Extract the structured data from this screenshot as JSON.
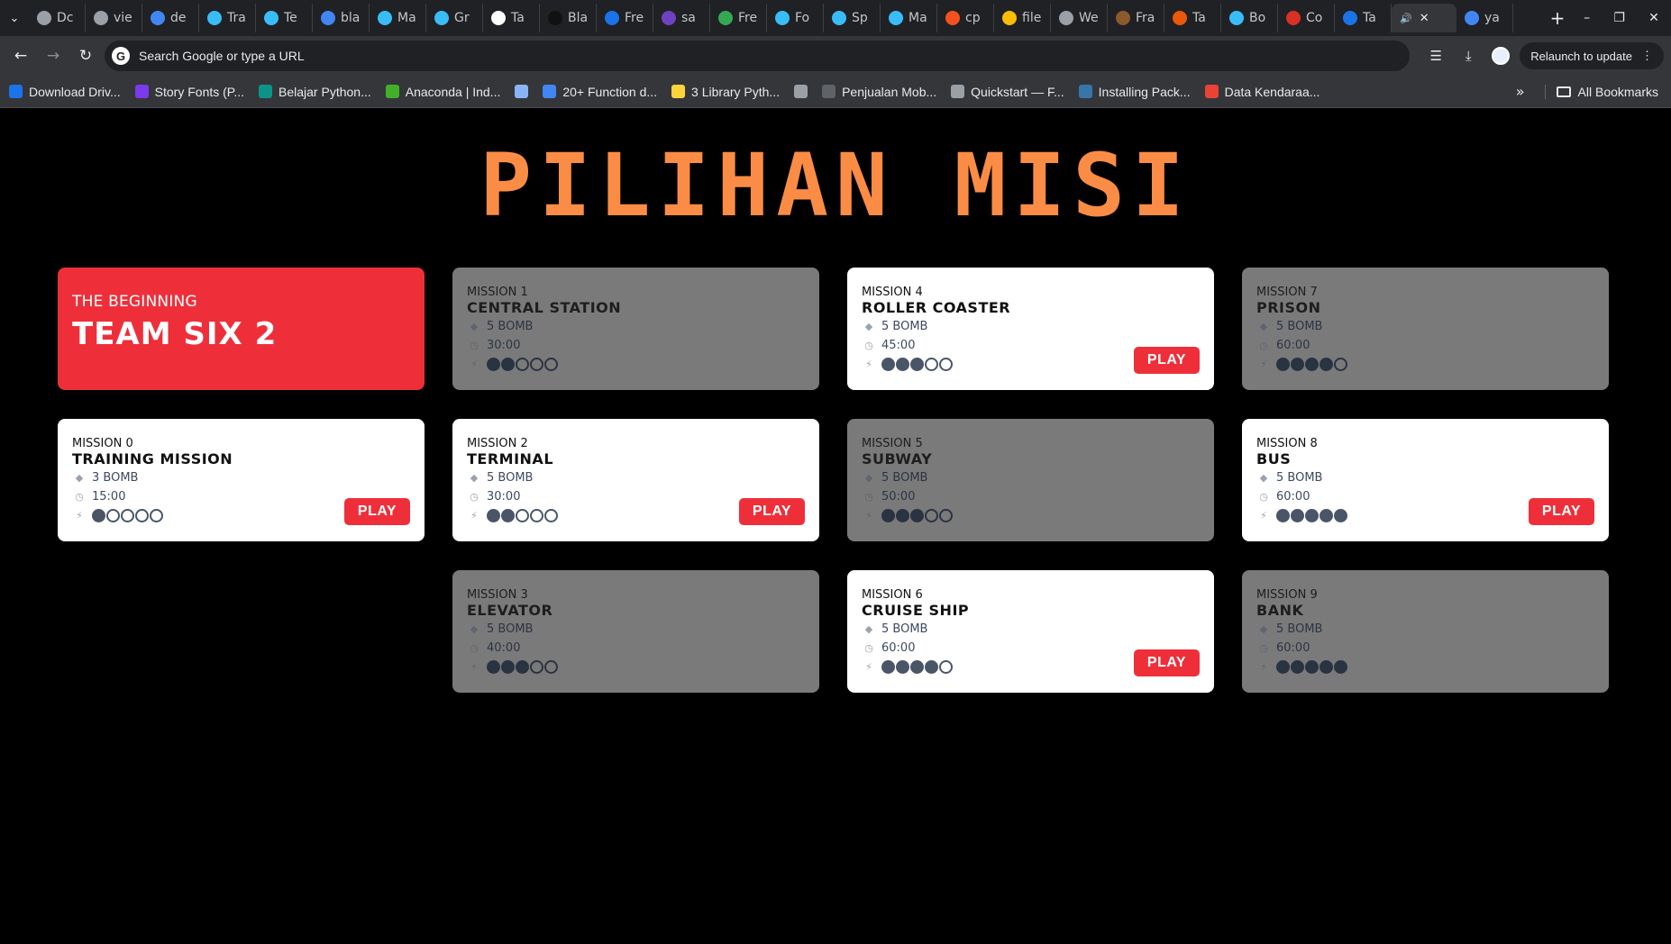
{
  "browser": {
    "tabs": [
      {
        "label": "Dc",
        "color": "#9aa0a6"
      },
      {
        "label": "vie",
        "color": "#9aa0a6"
      },
      {
        "label": "de",
        "color": "#4285f4"
      },
      {
        "label": "Tra",
        "color": "#38bdf8"
      },
      {
        "label": "Te",
        "color": "#38bdf8"
      },
      {
        "label": "bla",
        "color": "#4285f4"
      },
      {
        "label": "Ma",
        "color": "#38bdf8"
      },
      {
        "label": "Gr",
        "color": "#38bdf8"
      },
      {
        "label": "Ta",
        "color": "#ffffff"
      },
      {
        "label": "Bla",
        "color": "#111111"
      },
      {
        "label": "Fre",
        "color": "#1a73e8"
      },
      {
        "label": "sa",
        "color": "#6f42c1"
      },
      {
        "label": "Fre",
        "color": "#34a853"
      },
      {
        "label": "Fo",
        "color": "#38bdf8"
      },
      {
        "label": "Sp",
        "color": "#38bdf8"
      },
      {
        "label": "Ma",
        "color": "#38bdf8"
      },
      {
        "label": "cp",
        "color": "#f4511e"
      },
      {
        "label": "file",
        "color": "#fbbc04"
      },
      {
        "label": "We",
        "color": "#9aa0a6"
      },
      {
        "label": "Fra",
        "color": "#8b5a2b"
      },
      {
        "label": "Ta",
        "color": "#ea580c"
      },
      {
        "label": "Bo",
        "color": "#38bdf8"
      },
      {
        "label": "Co",
        "color": "#d93025"
      },
      {
        "label": "Ta",
        "color": "#1a73e8"
      }
    ],
    "active_tab": {
      "label": "ya",
      "color": "#4285f4"
    },
    "omnibox_placeholder": "Search Google or type a URL",
    "relaunch_label": "Relaunch to update",
    "bookmarks": [
      {
        "label": "Download Driv...",
        "color": "#1a73e8"
      },
      {
        "label": "Story Fonts (P...",
        "color": "#7c3aed"
      },
      {
        "label": "Belajar Python...",
        "color": "#0d9488"
      },
      {
        "label": "Anaconda | Ind...",
        "color": "#43b02a"
      },
      {
        "label": "",
        "color": "#8ab4f8"
      },
      {
        "label": "20+ Function d...",
        "color": "#4285f4"
      },
      {
        "label": "3 Library Pyth...",
        "color": "#ffd43b"
      },
      {
        "label": "",
        "color": "#9aa0a6"
      },
      {
        "label": "Penjualan Mob...",
        "color": "#5f6368"
      },
      {
        "label": "Quickstart — F...",
        "color": "#9aa0a6"
      },
      {
        "label": "Installing Pack...",
        "color": "#3776ab"
      },
      {
        "label": "Data Kendaraa...",
        "color": "#ea4335"
      }
    ],
    "all_bookmarks_label": "All Bookmarks"
  },
  "page": {
    "title": "PILIHAN MISI",
    "hero": {
      "subtitle": "THE BEGINNING",
      "title": "TEAM SIX 2"
    },
    "play_label": "PLAY",
    "missions": [
      {
        "label": "MISSION 0",
        "name": "TRAINING MISSION",
        "bombs": "3 BOMB",
        "time": "15:00",
        "difficulty": 1,
        "unlocked": true
      },
      {
        "label": "MISSION 1",
        "name": "CENTRAL STATION",
        "bombs": "5 BOMB",
        "time": "30:00",
        "difficulty": 2,
        "unlocked": false
      },
      {
        "label": "MISSION 2",
        "name": "TERMINAL",
        "bombs": "5 BOMB",
        "time": "30:00",
        "difficulty": 2,
        "unlocked": true
      },
      {
        "label": "MISSION 3",
        "name": "ELEVATOR",
        "bombs": "5 BOMB",
        "time": "40:00",
        "difficulty": 3,
        "unlocked": false
      },
      {
        "label": "MISSION 4",
        "name": "ROLLER COASTER",
        "bombs": "5 BOMB",
        "time": "45:00",
        "difficulty": 3,
        "unlocked": true
      },
      {
        "label": "MISSION 5",
        "name": "SUBWAY",
        "bombs": "5 BOMB",
        "time": "50:00",
        "difficulty": 3,
        "unlocked": false
      },
      {
        "label": "MISSION 6",
        "name": "CRUISE SHIP",
        "bombs": "5 BOMB",
        "time": "60:00",
        "difficulty": 4,
        "unlocked": true
      },
      {
        "label": "MISSION 7",
        "name": "PRISON",
        "bombs": "5 BOMB",
        "time": "60:00",
        "difficulty": 4,
        "unlocked": false
      },
      {
        "label": "MISSION 8",
        "name": "BUS",
        "bombs": "5 BOMB",
        "time": "60:00",
        "difficulty": 5,
        "unlocked": true
      },
      {
        "label": "MISSION 9",
        "name": "BANK",
        "bombs": "5 BOMB",
        "time": "60:00",
        "difficulty": 5,
        "unlocked": false
      }
    ],
    "max_difficulty": 5
  }
}
